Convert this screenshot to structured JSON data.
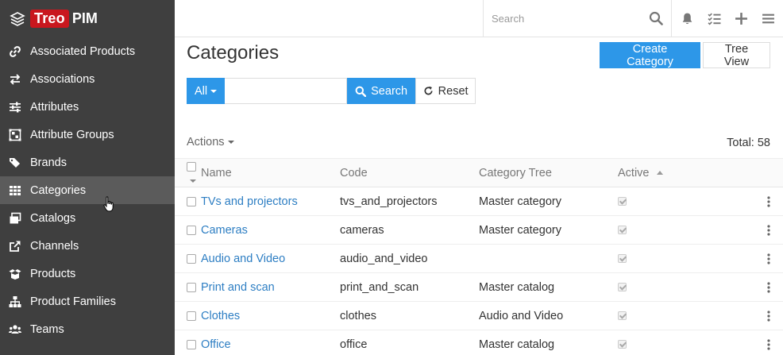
{
  "brand": {
    "part1": "Treo",
    "part2": "PIM"
  },
  "sidebar": {
    "items": [
      {
        "label": "Associated Products",
        "icon": "link-icon"
      },
      {
        "label": "Associations",
        "icon": "arrows-exchange-icon"
      },
      {
        "label": "Attributes",
        "icon": "sliders-icon"
      },
      {
        "label": "Attribute Groups",
        "icon": "group-icon"
      },
      {
        "label": "Brands",
        "icon": "tags-icon"
      },
      {
        "label": "Categories",
        "icon": "grid-icon",
        "active": true
      },
      {
        "label": "Catalogs",
        "icon": "windows-icon"
      },
      {
        "label": "Channels",
        "icon": "external-link-icon"
      },
      {
        "label": "Products",
        "icon": "box-open-icon"
      },
      {
        "label": "Product Families",
        "icon": "sitemap-icon"
      },
      {
        "label": "Teams",
        "icon": "users-icon"
      }
    ]
  },
  "topbar": {
    "search_placeholder": "Search"
  },
  "page": {
    "title": "Categories",
    "create_label": "Create Category",
    "tree_view_label": "Tree View"
  },
  "filter": {
    "scope_label": "All",
    "input_value": "",
    "search_label": "Search",
    "reset_label": "Reset"
  },
  "list": {
    "actions_label": "Actions",
    "total_label": "Total:",
    "total_value": "58",
    "columns": {
      "name": "Name",
      "code": "Code",
      "tree": "Category Tree",
      "active": "Active"
    },
    "rows": [
      {
        "name": "TVs and projectors",
        "code": "tvs_and_projectors",
        "tree": "Master category",
        "active": true
      },
      {
        "name": "Cameras",
        "code": "cameras",
        "tree": "Master category",
        "active": true
      },
      {
        "name": "Audio and Video",
        "code": "audio_and_video",
        "tree": "",
        "active": true
      },
      {
        "name": "Print and scan",
        "code": "print_and_scan",
        "tree": "Master catalog",
        "active": true
      },
      {
        "name": "Clothes",
        "code": "clothes",
        "tree": "Audio and Video",
        "active": true
      },
      {
        "name": "Office",
        "code": "office",
        "tree": "Master catalog",
        "active": true
      }
    ]
  },
  "colors": {
    "sidebar_bg": "#3f3f3f",
    "accent": "#2d97e8",
    "brand_red": "#c9171e",
    "link": "#2d7ec3"
  }
}
